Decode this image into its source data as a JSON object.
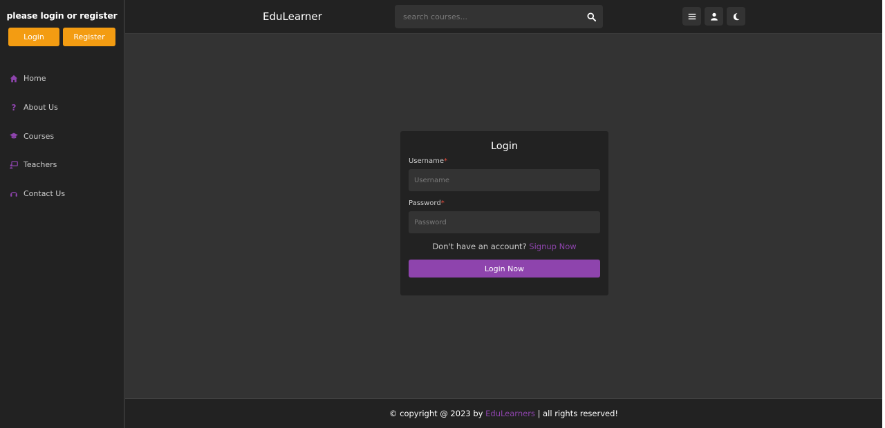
{
  "sidebar": {
    "prompt": "please login or register",
    "login_label": "Login",
    "register_label": "Register",
    "items": [
      {
        "label": "Home",
        "icon": "home-icon"
      },
      {
        "label": "About Us",
        "icon": "question-icon"
      },
      {
        "label": "Courses",
        "icon": "graduation-cap-icon"
      },
      {
        "label": "Teachers",
        "icon": "chalkboard-teacher-icon"
      },
      {
        "label": "Contact Us",
        "icon": "headset-icon"
      }
    ]
  },
  "header": {
    "brand": "EduLearner",
    "search_placeholder": "search courses...",
    "icons": [
      "menu-icon",
      "user-icon",
      "moon-icon"
    ]
  },
  "login": {
    "title": "Login",
    "username_label": "Username",
    "username_placeholder": "Username",
    "password_label": "Password",
    "password_placeholder": "Password",
    "required_mark": "*",
    "signup_prompt": "Don't have an account?",
    "signup_link": "Signup Now",
    "submit_label": "Login Now"
  },
  "footer": {
    "prefix": "© copyright @ 2023 by",
    "brand": "EduLearners",
    "suffix": "| all rights reserved!"
  },
  "colors": {
    "accent": "#8e44ad",
    "orange": "#f39c12",
    "panel": "#222222",
    "background": "#333333"
  }
}
